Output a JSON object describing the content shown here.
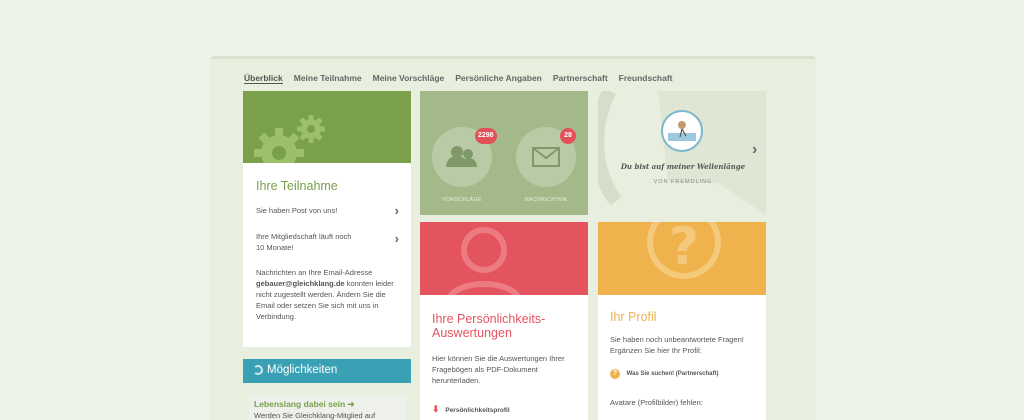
{
  "tabs": [
    "Überblick",
    "Meine Teilnahme",
    "Meine Vorschläge",
    "Persönliche Angaben",
    "Partnerschaft",
    "Freundschaft"
  ],
  "teilnahme": {
    "title": "Ihre Teilnahme",
    "post": "Sie haben Post von uns!",
    "membership": "Ihre Mitgliedschaft läuft noch 10 Monate!",
    "email_pre": "Nachrichten an Ihre Email-Adresse",
    "email": "gebauer@gleichklang.de",
    "email_post": "konnten leider nicht zugestellt werden. Ändern Sie die Email oder setzen Sie sich mit uns in Verbindung."
  },
  "moeglichkeiten": {
    "title": "Möglichkeiten",
    "link": "Lebenslang dabei sein",
    "text": "Werden Sie Gleichklang-Mitglied auf"
  },
  "stats": {
    "proposals_count": "2298",
    "proposals_label": "VORSCHLÄGE",
    "messages_count": "28",
    "messages_label": "NACHRICHTEN"
  },
  "quote": {
    "text": "Du bist auf meiner Wellenlänge",
    "author": "VON FREMDLING"
  },
  "persoenlichkeit": {
    "title": "Ihre Persönlichkeits-Auswertungen",
    "text": "Hier können Sie die Auswertungen Ihrer Fragebögen als PDF-Dokument herunterladen.",
    "link": "Persönlichkeitsprofil"
  },
  "profil": {
    "title": "Ihr Profil",
    "text": "Sie haben noch unbeantwortete Fragen! Ergänzen Sie hier Ihr Profil:",
    "link": "Was Sie suchen! (Partnerschaft)",
    "avatar_text": "Avatare (Profilbilder) fehlen:"
  },
  "colors": {
    "green": "#7aa04c",
    "teal": "#3aa0b4",
    "red": "#e4545e",
    "orange": "#f0b24c",
    "badge": "#e4505a"
  }
}
